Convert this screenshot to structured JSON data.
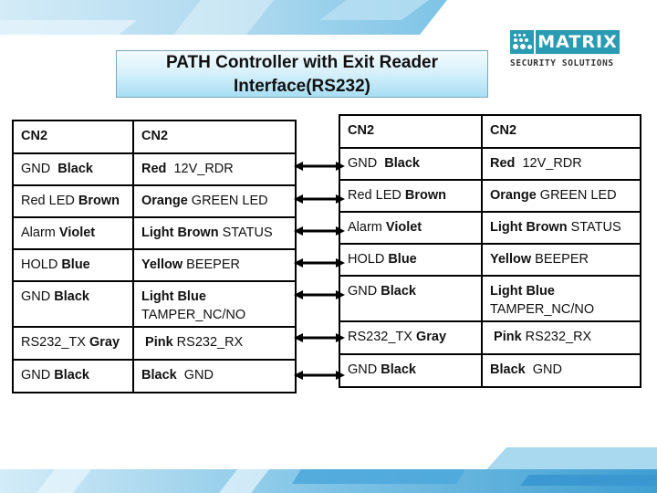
{
  "title": {
    "line1": "PATH Controller with Exit Reader",
    "line2": "Interface(RS232)"
  },
  "logo": {
    "icon": "matrix-dots-icon",
    "word": "MATRIX",
    "tagline": "SECURITY SOLUTIONS",
    "brand_color": "#2b9bb3"
  },
  "colors": {
    "title_box_top": "#f4fbfe",
    "title_box_bottom": "#a8def3",
    "banner": "#5bb3dd",
    "border": "#000000"
  },
  "left_table": {
    "rows": [
      {
        "c1": [
          {
            "t": "CN2",
            "b": true
          }
        ],
        "c2": [
          {
            "t": "CN2",
            "b": true
          }
        ]
      },
      {
        "c1": [
          {
            "t": "GND  ",
            "b": false
          },
          {
            "t": "Black",
            "b": true
          }
        ],
        "c2": [
          {
            "t": "Red",
            "b": true
          },
          {
            "t": "  12V_RDR",
            "b": false
          }
        ]
      },
      {
        "c1": [
          {
            "t": "Red LED ",
            "b": false
          },
          {
            "t": "Brown",
            "b": true
          }
        ],
        "c2": [
          {
            "t": "Orange",
            "b": true
          },
          {
            "t": " GREEN LED",
            "b": false
          }
        ]
      },
      {
        "c1": [
          {
            "t": "Alarm ",
            "b": false
          },
          {
            "t": "Violet",
            "b": true
          }
        ],
        "c2": [
          {
            "t": "Light Brown",
            "b": true
          },
          {
            "t": " STATUS",
            "b": false
          }
        ]
      },
      {
        "c1": [
          {
            "t": "HOLD ",
            "b": false
          },
          {
            "t": "Blue",
            "b": true
          }
        ],
        "c2": [
          {
            "t": "Yellow",
            "b": true
          },
          {
            "t": " BEEPER",
            "b": false
          }
        ]
      },
      {
        "c1": [
          {
            "t": "GND ",
            "b": false
          },
          {
            "t": "Black",
            "b": true
          }
        ],
        "c2": [
          {
            "t": "Light Blue",
            "b": true
          },
          {
            "t": "\nTAMPER_NC/NO",
            "b": false
          }
        ]
      },
      {
        "c1": [
          {
            "t": "RS232_TX ",
            "b": false
          },
          {
            "t": "Gray",
            "b": true
          }
        ],
        "c2": [
          {
            "t": " Pink",
            "b": true
          },
          {
            "t": " RS232_RX",
            "b": false
          }
        ]
      },
      {
        "c1": [
          {
            "t": "GND ",
            "b": false
          },
          {
            "t": "Black",
            "b": true
          }
        ],
        "c2": [
          {
            "t": "Black",
            "b": true
          },
          {
            "t": "  GND",
            "b": false
          }
        ]
      }
    ]
  },
  "right_table": {
    "rows": [
      {
        "c1": [
          {
            "t": "CN2",
            "b": true
          }
        ],
        "c2": [
          {
            "t": "CN2",
            "b": true
          }
        ]
      },
      {
        "c1": [
          {
            "t": "GND  ",
            "b": false
          },
          {
            "t": "Black",
            "b": true
          }
        ],
        "c2": [
          {
            "t": "Red",
            "b": true
          },
          {
            "t": "  12V_RDR",
            "b": false
          }
        ]
      },
      {
        "c1": [
          {
            "t": "Red LED ",
            "b": false
          },
          {
            "t": "Brown",
            "b": true
          }
        ],
        "c2": [
          {
            "t": "Orange",
            "b": true
          },
          {
            "t": " GREEN LED",
            "b": false
          }
        ]
      },
      {
        "c1": [
          {
            "t": "Alarm ",
            "b": false
          },
          {
            "t": "Violet",
            "b": true
          }
        ],
        "c2": [
          {
            "t": "Light Brown",
            "b": true
          },
          {
            "t": " STATUS",
            "b": false
          }
        ]
      },
      {
        "c1": [
          {
            "t": "HOLD ",
            "b": false
          },
          {
            "t": "Blue",
            "b": true
          }
        ],
        "c2": [
          {
            "t": "Yellow",
            "b": true
          },
          {
            "t": " BEEPER",
            "b": false
          }
        ]
      },
      {
        "c1": [
          {
            "t": "GND ",
            "b": false
          },
          {
            "t": "Black",
            "b": true
          }
        ],
        "c2": [
          {
            "t": "Light Blue",
            "b": true
          },
          {
            "t": "\nTAMPER_NC/NO",
            "b": false
          }
        ]
      },
      {
        "c1": [
          {
            "t": "RS232_TX ",
            "b": false
          },
          {
            "t": "Gray",
            "b": true
          }
        ],
        "c2": [
          {
            "t": " Pink",
            "b": true
          },
          {
            "t": " RS232_RX",
            "b": false
          }
        ]
      },
      {
        "c1": [
          {
            "t": "GND ",
            "b": false
          },
          {
            "t": "Black",
            "b": true
          }
        ],
        "c2": [
          {
            "t": "Black",
            "b": true
          },
          {
            "t": "  GND",
            "b": false
          }
        ]
      }
    ]
  },
  "connections": {
    "count": 7,
    "icon": "double-arrow-icon",
    "from_rows": [
      1,
      2,
      3,
      4,
      5,
      6,
      7
    ]
  }
}
